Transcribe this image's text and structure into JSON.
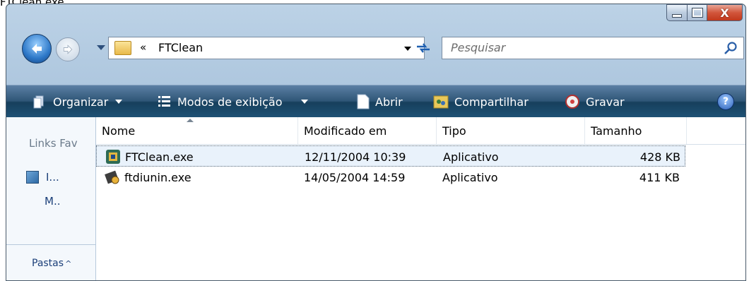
{
  "caption": "FTClean.exe",
  "window": {
    "buttons": {
      "minimize": "minimize-button",
      "maximize": "maximize-button",
      "close": "X"
    }
  },
  "address": {
    "chevron": "«",
    "path": "FTClean"
  },
  "search": {
    "placeholder": "Pesquisar"
  },
  "toolbar": {
    "organize": "Organizar",
    "views": "Modos de exibição",
    "open": "Abrir",
    "share": "Compartilhar",
    "burn": "Gravar",
    "help": "?"
  },
  "navpane": {
    "links_title": "Links Fav",
    "link1": "I...",
    "link2": "M..",
    "folders": "Pastas"
  },
  "columns": [
    "Nome",
    "Modificado em",
    "Tipo",
    "Tamanho"
  ],
  "files": [
    {
      "name": "FTClean.exe",
      "modified": "12/11/2004 10:39",
      "type": "Aplicativo",
      "size": "428 KB"
    },
    {
      "name": "ftdiunin.exe",
      "modified": "14/05/2004 14:59",
      "type": "Aplicativo",
      "size": "411 KB"
    }
  ],
  "colors": {
    "accent": "#2f5677",
    "selection": "#e9f2fb"
  }
}
